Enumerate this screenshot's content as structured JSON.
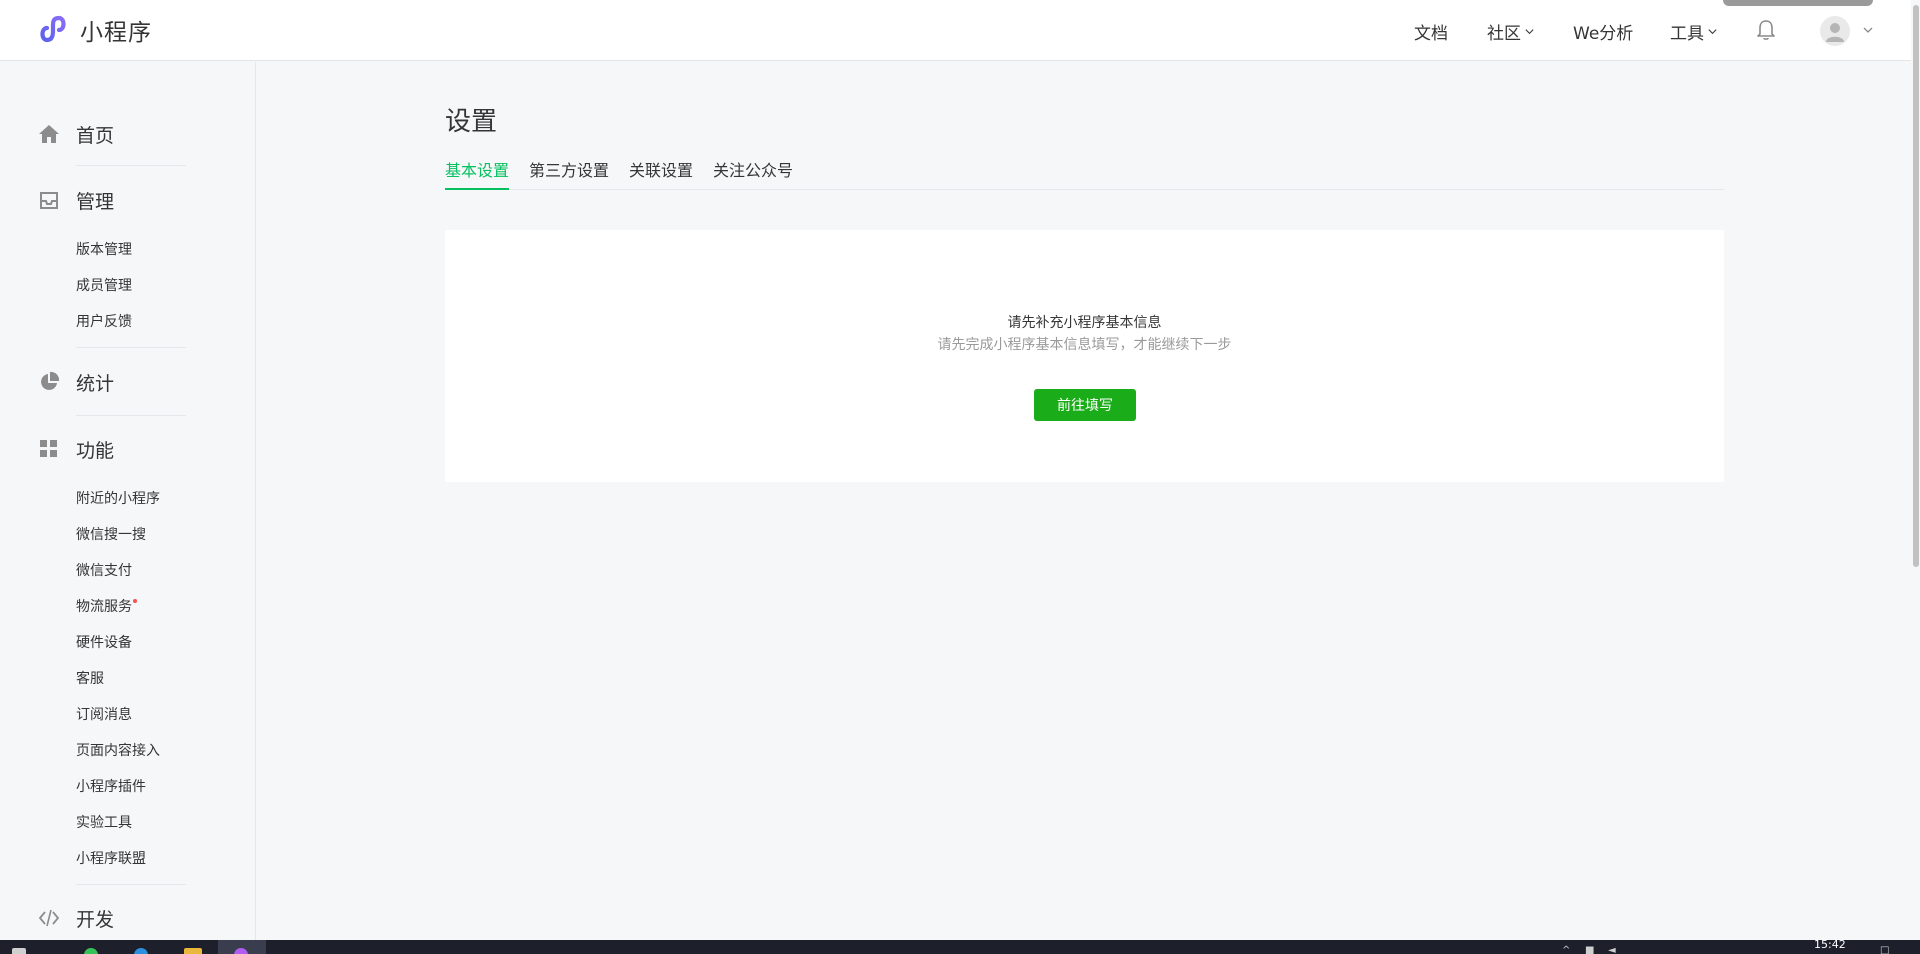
{
  "brand": {
    "title": "小程序",
    "logo_icon": "miniprogram-logo-icon",
    "logo_color": "#6467f0"
  },
  "topnav": {
    "docs": "文档",
    "community": "社区",
    "analytics": "We分析",
    "tools": "工具",
    "bell_icon": "bell-icon",
    "avatar_icon": "user-avatar-icon"
  },
  "sidebar": {
    "home": {
      "label": "首页",
      "icon": "home-icon"
    },
    "manage": {
      "label": "管理",
      "icon": "inbox-icon",
      "items": [
        "版本管理",
        "成员管理",
        "用户反馈"
      ]
    },
    "stats": {
      "label": "统计",
      "icon": "pie-chart-icon"
    },
    "features": {
      "label": "功能",
      "icon": "grid-icon",
      "items": [
        "附近的小程序",
        "微信搜一搜",
        "微信支付",
        "物流服务",
        "硬件设备",
        "客服",
        "订阅消息",
        "页面内容接入",
        "小程序插件",
        "实验工具",
        "小程序联盟"
      ]
    },
    "dev": {
      "label": "开发",
      "icon": "code-icon"
    }
  },
  "main": {
    "title": "设置",
    "tabs": [
      "基本设置",
      "第三方设置",
      "关联设置",
      "关注公众号"
    ],
    "active_tab": 0,
    "card": {
      "title": "请先补充小程序基本信息",
      "desc": "请先完成小程序基本信息填写，才能继续下一步",
      "button": "前往填写"
    }
  },
  "taskbar": {
    "clock": "15:42"
  },
  "colors": {
    "accent_green": "#07c160",
    "button_green": "#1aad19",
    "background": "#f6f7f9",
    "sidebar_icon": "#9a9a9a",
    "muted_text": "#9a9a9a"
  }
}
